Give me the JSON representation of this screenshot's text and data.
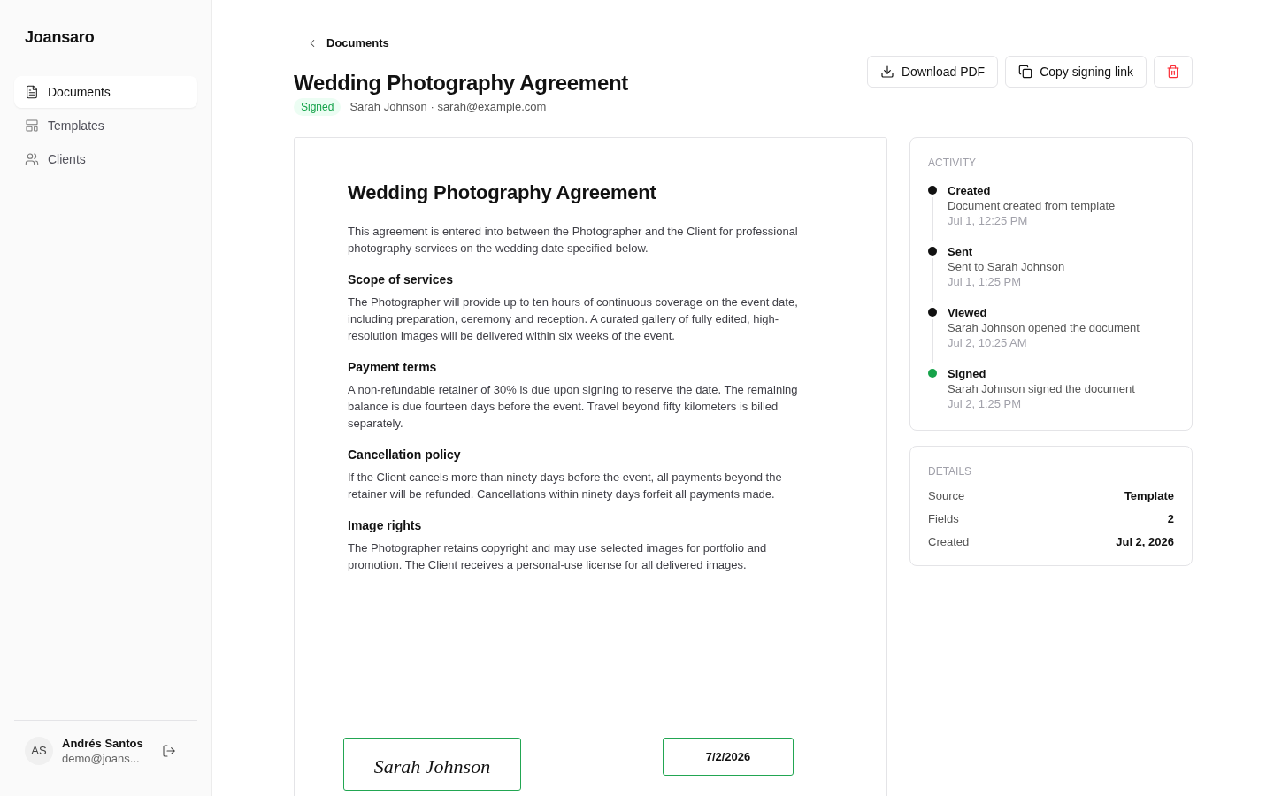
{
  "sidebar": {
    "brand": "Joansaro",
    "items": [
      {
        "label": "Documents",
        "selected": true
      },
      {
        "label": "Templates",
        "selected": false
      },
      {
        "label": "Clients",
        "selected": false
      }
    ],
    "user": {
      "initials": "AS",
      "name": "Andrés Santos",
      "email": "demo@joans..."
    }
  },
  "header": {
    "back_link": "Documents",
    "title": "Wedding Photography Agreement",
    "status": "Signed",
    "recipient": "Sarah Johnson · sarah@example.com",
    "actions": [
      {
        "kind": "download",
        "label": "Download PDF"
      },
      {
        "kind": "copy",
        "label": "Copy signing link"
      },
      {
        "kind": "delete"
      }
    ]
  },
  "document": {
    "title": "Wedding Photography Agreement",
    "intro": "This agreement is entered into between the Photographer and the Client for professional photography services on the wedding date specified below.",
    "sections": [
      {
        "heading": "Scope of services",
        "body": "The Photographer will provide up to ten hours of continuous coverage on the event date, including preparation, ceremony and reception. A curated gallery of fully edited, high-resolution images will be delivered within six weeks of the event."
      },
      {
        "heading": "Payment terms",
        "body": "A non-refundable retainer of 30% is due upon signing to reserve the date. The remaining balance is due fourteen days before the event. Travel beyond fifty kilometers is billed separately."
      },
      {
        "heading": "Cancellation policy",
        "body": "If the Client cancels more than ninety days before the event, all payments beyond the retainer will be refunded. Cancellations within ninety days forfeit all payments made."
      },
      {
        "heading": "Image rights",
        "body": "The Photographer retains copyright and may use selected images for portfolio and promotion. The Client receives a personal-use license for all delivered images."
      }
    ],
    "fields": [
      {
        "kind": "signature",
        "value": "Sarah Johnson",
        "filled": true
      },
      {
        "kind": "date",
        "value": "7/2/2026",
        "filled": true
      }
    ]
  },
  "activity": {
    "title": "ACTIVITY",
    "events": [
      {
        "title": "Created",
        "description": "Document created from template",
        "time": "Jul 1, 12:25 PM",
        "color": "#111111"
      },
      {
        "title": "Sent",
        "description": "Sent to Sarah Johnson",
        "time": "Jul 1, 1:25 PM",
        "color": "#111111"
      },
      {
        "title": "Viewed",
        "description": "Sarah Johnson opened the document",
        "time": "Jul 2, 10:25 AM",
        "color": "#111111"
      },
      {
        "title": "Signed",
        "description": "Sarah Johnson signed the document",
        "time": "Jul 2, 1:25 PM",
        "color": "#16a34a"
      }
    ]
  },
  "details": {
    "title": "DETAILS",
    "rows": [
      {
        "label": "Source",
        "value": "Template"
      },
      {
        "label": "Fields",
        "value": "2"
      },
      {
        "label": "Created",
        "value": "Jul 2, 2026"
      }
    ]
  }
}
